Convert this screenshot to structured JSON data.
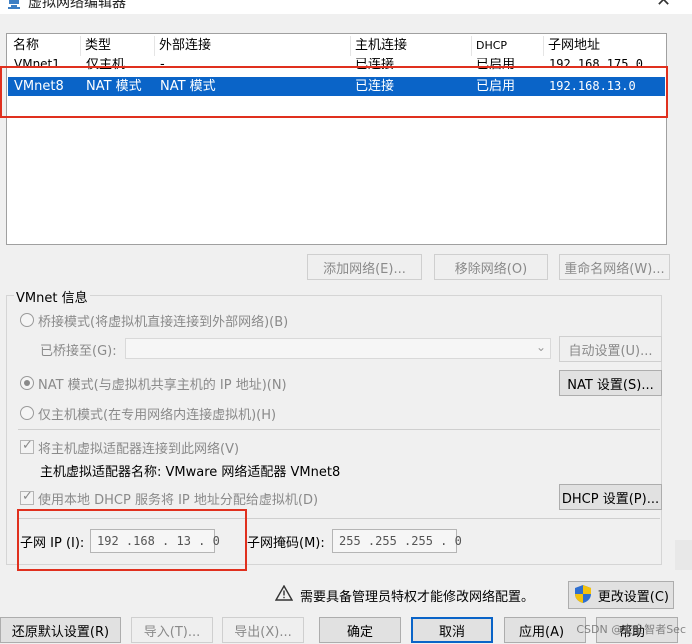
{
  "window": {
    "title": "虚拟网络编辑器"
  },
  "table": {
    "columns": [
      "名称",
      "类型",
      "外部连接",
      "主机连接",
      "DHCP",
      "子网地址"
    ],
    "rows": [
      {
        "name": "VMnet1",
        "type": "仅主机...",
        "external": "-",
        "host": "已连接",
        "dhcp": "已启用",
        "subnet": "192.168.175.0"
      },
      {
        "name": "VMnet8",
        "type": "NAT 模式",
        "external": "NAT 模式",
        "host": "已连接",
        "dhcp": "已启用",
        "subnet": "192.168.13.0"
      }
    ]
  },
  "table_buttons": {
    "add": "添加网络(E)...",
    "remove": "移除网络(O)",
    "rename": "重命名网络(W)..."
  },
  "vmnet_info": {
    "title": "VMnet 信息",
    "bridged_label": "桥接模式(将虚拟机直接连接到外部网络)(B)",
    "bridged_to_label": "已桥接至(G):",
    "bridged_to_value": "",
    "auto_settings": "自动设置(U)...",
    "nat_label": "NAT 模式(与虚拟机共享主机的 IP 地址)(N)",
    "nat_settings": "NAT 设置(S)...",
    "hostonly_label": "仅主机模式(在专用网络内连接虚拟机)(H)",
    "connect_adapter_label": "将主机虚拟适配器连接到此网络(V)",
    "adapter_name_label": "主机虚拟适配器名称: VMware 网络适配器 VMnet8",
    "dhcp_label": "使用本地 DHCP 服务将 IP 地址分配给虚拟机(D)",
    "dhcp_settings": "DHCP 设置(P)...",
    "subnet_ip_label": "子网 IP (I):",
    "subnet_ip_value": "192 .168 . 13  .  0",
    "subnet_mask_label": "子网掩码(M):",
    "subnet_mask_value": "255 .255 .255 .  0"
  },
  "admin_notice": {
    "text": "需要具备管理员特权才能修改网络配置。",
    "change_settings": "更改设置(C)"
  },
  "footer": {
    "restore": "还原默认设置(R)",
    "import": "导入(T)...",
    "export": "导出(X)...",
    "ok": "确定",
    "cancel": "取消",
    "apply": "应用(A)",
    "help": "帮助"
  },
  "watermark": "CSDN @安全智者Sec",
  "colors": {
    "selection": "#0a64c8",
    "highlight_box": "#e0301e",
    "button_face": "#e1e1e1"
  }
}
